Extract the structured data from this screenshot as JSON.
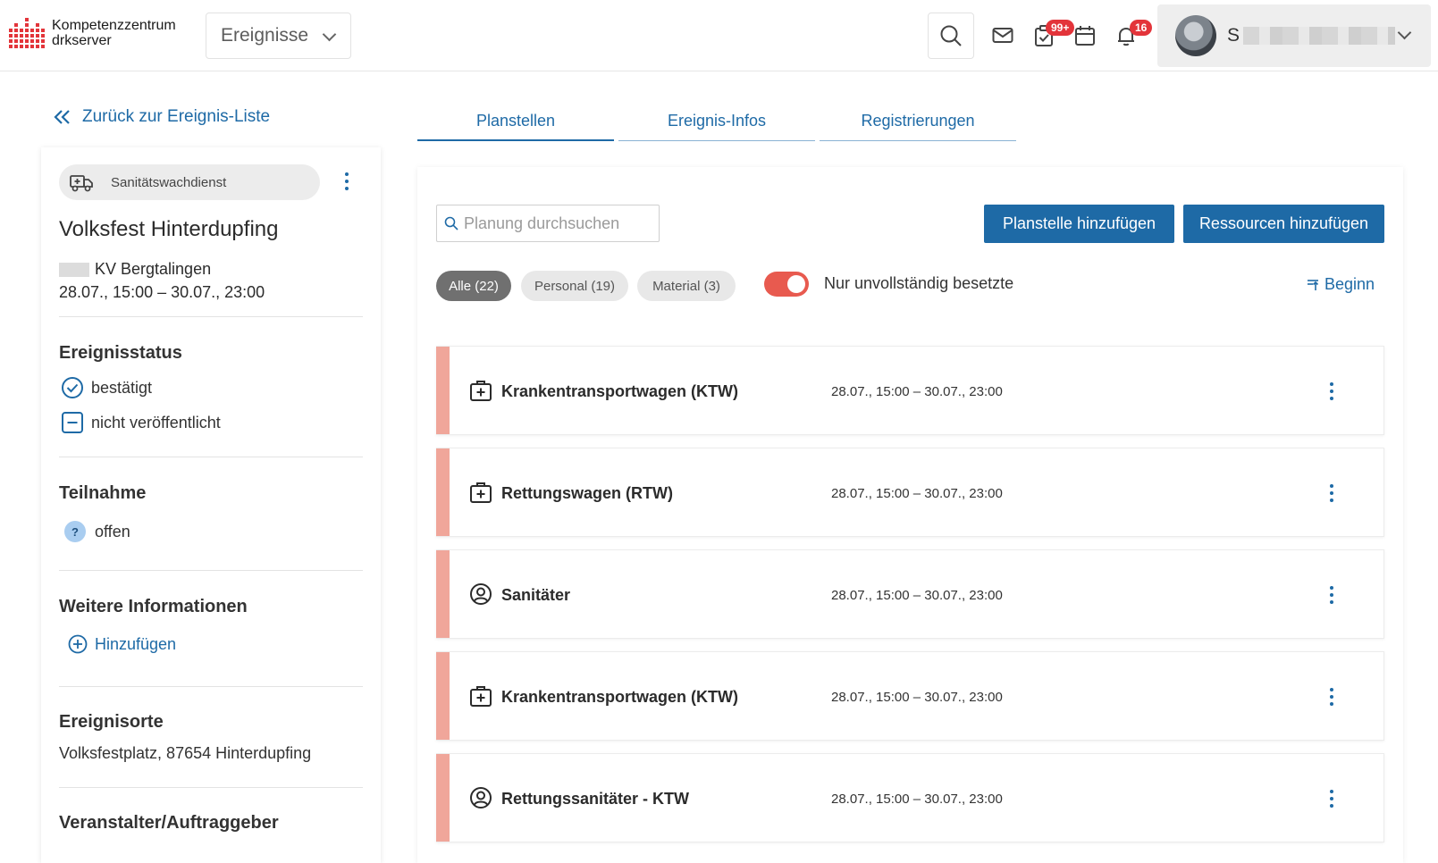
{
  "header": {
    "logo_line1": "Kompetenzzentrum",
    "logo_line2": "drkserver",
    "nav_select_value": "Ereignisse",
    "tasks_badge": "99+",
    "notifications_badge": "16",
    "user_initial": "S",
    "brand_color": "#e3343a"
  },
  "sidebar": {
    "back_label": "Zurück zur Ereignis-Liste",
    "category": "Sanitätswachdienst",
    "event_title": "Volksfest Hinterdupfing",
    "event_org": "KV Bergtalingen",
    "event_date": "28.07., 15:00 – 30.07., 23:00",
    "status_title": "Ereignisstatus",
    "status_confirmed": "bestätigt",
    "status_unpublished": "nicht veröffentlicht",
    "participation_title": "Teilnahme",
    "participation_value": "offen",
    "more_info_title": "Weitere Informationen",
    "add_label": "Hinzufügen",
    "locations_title": "Ereignisorte",
    "location_value": "Volksfestplatz, 87654 Hinterdupfing",
    "organizer_title": "Veranstalter/Auftraggeber"
  },
  "tabs": [
    {
      "label": "Planstellen",
      "active": true
    },
    {
      "label": "Ereignis-Infos",
      "active": false
    },
    {
      "label": "Registrierungen",
      "active": false
    }
  ],
  "toolbar": {
    "search_placeholder": "Planung durchsuchen",
    "add_position_label": "Planstelle hinzufügen",
    "add_resources_label": "Ressourcen hinzufügen",
    "accent_color": "#1e6aa6"
  },
  "filters": {
    "all": "Alle (22)",
    "personnel": "Personal (19)",
    "material": "Material (3)",
    "only_incomplete_label": "Nur unvollständig besetzte",
    "only_incomplete_on": true,
    "sort_label": "Beginn"
  },
  "positions": [
    {
      "icon": "medical-case-icon",
      "title": "Krankentransportwagen (KTW)",
      "time": "28.07., 15:00 – 30.07., 23:00"
    },
    {
      "icon": "medical-case-icon",
      "title": "Rettungswagen (RTW)",
      "time": "28.07., 15:00 – 30.07., 23:00"
    },
    {
      "icon": "person-circle-icon",
      "title": "Sanitäter",
      "time": "28.07., 15:00 – 30.07., 23:00"
    },
    {
      "icon": "medical-case-icon",
      "title": "Krankentransportwagen (KTW)",
      "time": "28.07., 15:00 – 30.07., 23:00"
    },
    {
      "icon": "person-circle-icon",
      "title": "Rettungssanitäter - KTW",
      "time": "28.07., 15:00 – 30.07., 23:00"
    }
  ]
}
